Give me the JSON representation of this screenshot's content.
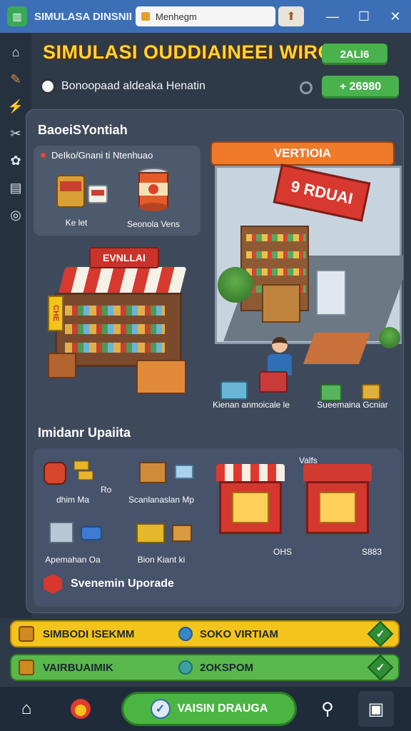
{
  "window": {
    "app_title": "SIMULASA DINSNIEAS",
    "url": "Menhegm",
    "minimize": "—",
    "maximize": "☐",
    "close": "✕"
  },
  "sidebar": {
    "items": [
      {
        "icon": "home-icon",
        "glyph": "⌂"
      },
      {
        "icon": "paint-icon",
        "glyph": "✎"
      },
      {
        "icon": "runner-icon",
        "glyph": "⚡"
      },
      {
        "icon": "crossed-tools-icon",
        "glyph": "✂"
      },
      {
        "icon": "cookie-icon",
        "glyph": "✿"
      },
      {
        "icon": "book-icon",
        "glyph": "▤"
      },
      {
        "icon": "target-icon",
        "glyph": "◎"
      }
    ]
  },
  "header": {
    "title": "SIMULASI OUDDIAINEEI WIROIAI",
    "level": "2ALI6",
    "subtitle": "Bonoopaad aldeaka Henatin",
    "cash": "+ 26980"
  },
  "boosts": {
    "title": "BaoeiSYontiah",
    "card_header": "DeIko/Gnani ti Ntenhuao",
    "items": [
      {
        "label": "Ke let"
      },
      {
        "label": "Seonola Vens"
      }
    ]
  },
  "scene": {
    "left_sign": "EVNLLAI",
    "left_side_sign": "CHE",
    "right_banner": "VERTIOIA",
    "right_sign": "9 RDUAI",
    "label_pack": "Kienan anmoicale le",
    "label_shelf": "Sueemaina Gcniar"
  },
  "upgrades": {
    "title": "Imidanr Upaiita",
    "vals_label": "Valfs",
    "items": [
      {
        "label": "Ro dhim Ma"
      },
      {
        "label": "Scanlanaslan Mp"
      },
      {
        "label": "Apemahan Oa"
      },
      {
        "label": "Bion Kiant ki"
      }
    ],
    "machines": [
      {
        "price": "OHS"
      },
      {
        "price": "S883"
      }
    ],
    "system_upgrade": "Svenemin Uporade"
  },
  "quests": [
    {
      "label": "SIMBODI ISEKMM",
      "reward": "SOKO VIRTIAM",
      "color": "#f2c41c"
    },
    {
      "label": "VAIRBUAIMIK",
      "reward": "2OKSPOM",
      "color": "#58b84b"
    }
  ],
  "bottom_nav": {
    "play_label": "VAISIN DRAUGA"
  }
}
